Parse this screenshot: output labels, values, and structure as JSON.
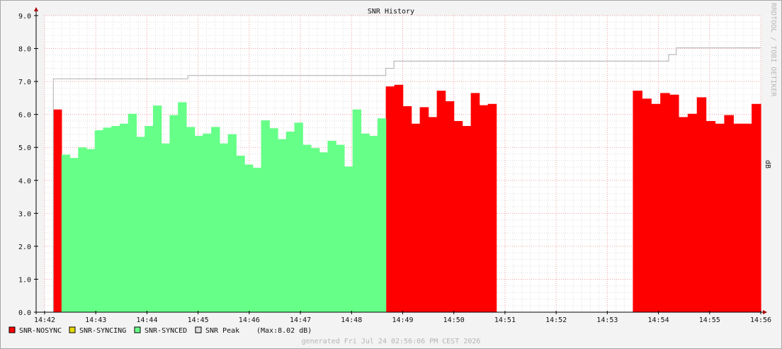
{
  "chart_data": {
    "type": "area",
    "title": "SNR History",
    "ylabel": "dB",
    "ylim": [
      0,
      9
    ],
    "y_ticks": [
      "0.0",
      "1.0",
      "2.0",
      "3.0",
      "4.0",
      "5.0",
      "6.0",
      "7.0",
      "8.0",
      "9.0"
    ],
    "x_ticks": [
      "14:42",
      "14:43",
      "14:44",
      "14:45",
      "14:46",
      "14:47",
      "14:48",
      "14:49",
      "14:50",
      "14:51",
      "14:52",
      "14:53",
      "14:54",
      "14:55",
      "14:56"
    ],
    "x_range_minutes": [
      0,
      14
    ],
    "x_unit": "minutes after 14:42",
    "grid": true,
    "watermark": "RRDTOOL / TOBI OETIKER",
    "colors": {
      "nosync": "#ff0000",
      "syncing": "#e6d800",
      "synced": "#66ff88",
      "peak": "#b0b0b0",
      "grid_major": "#f0a0a0",
      "grid_minor": "#dedede"
    },
    "series": [
      {
        "name": "SNR-NOSYNC",
        "segments": [
          {
            "x0": 0.17,
            "x1": 0.33,
            "values": [
              6.15
            ]
          },
          {
            "x0": 6.67,
            "x1": 8.83,
            "values": [
              6.85,
              6.9,
              6.25,
              5.72,
              6.22,
              5.92,
              6.72,
              6.4,
              5.8,
              5.65,
              6.65,
              6.28,
              6.32
            ]
          },
          {
            "x0": 11.5,
            "x1": 14.0,
            "values": [
              6.72,
              6.48,
              6.32,
              6.65,
              6.6,
              5.92,
              6.02,
              6.52,
              5.8,
              5.72,
              5.98,
              5.72,
              5.72,
              6.32
            ]
          }
        ]
      },
      {
        "name": "SNR-SYNCING",
        "segments": []
      },
      {
        "name": "SNR-SYNCED",
        "segments": [
          {
            "x0": 0.33,
            "x1": 6.67,
            "values": [
              4.78,
              4.68,
              5.0,
              4.95,
              5.52,
              5.6,
              5.65,
              5.72,
              6.02,
              5.32,
              5.65,
              6.27,
              5.12,
              5.98,
              6.37,
              5.62,
              5.35,
              5.42,
              5.62,
              5.12,
              5.4,
              4.75,
              4.48,
              4.38,
              5.82,
              5.58,
              5.25,
              5.48,
              5.75,
              5.08,
              4.98,
              4.85,
              5.2,
              5.08,
              4.42,
              6.15,
              5.42,
              5.35,
              5.88
            ]
          }
        ]
      }
    ],
    "peak": {
      "name": "SNR Peak",
      "steps": [
        [
          0.17,
          7.08
        ],
        [
          2.8,
          7.18
        ],
        [
          6.67,
          7.4
        ],
        [
          6.83,
          7.62
        ],
        [
          12.2,
          7.82
        ],
        [
          12.35,
          8.02
        ],
        [
          14.0,
          8.02
        ]
      ]
    }
  },
  "legend": {
    "nosync": "SNR-NOSYNC",
    "syncing": "SNR-SYNCING",
    "synced": "SNR-SYNCED",
    "peak": "SNR Peak",
    "peak_max": "(Max:8.02 dB)"
  },
  "footer": "generated Fri Jul 24 02:56:06 PM CEST 2026"
}
